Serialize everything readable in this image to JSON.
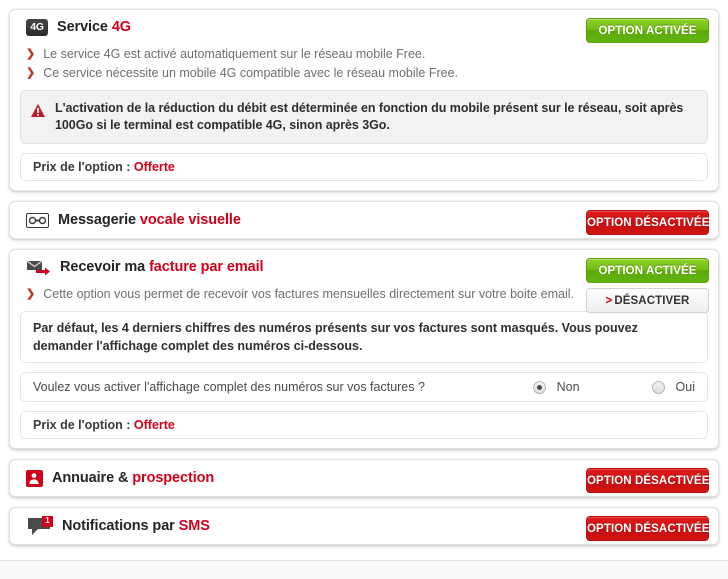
{
  "sections": [
    {
      "id": "service-4g",
      "icon": "4g-badge-icon",
      "icon_text": "4G",
      "title_plain": "Service ",
      "title_highlight": "4G",
      "primary_button": "OPTION ACTIVÉE",
      "bullets": [
        "Le service 4G est activé automatiquement sur le réseau mobile Free.",
        "Ce service nécessite un mobile 4G compatible avec le réseau mobile Free."
      ],
      "warning": "L'activation de la réduction du débit est déterminée en fonction du mobile présent sur le réseau, soit après 100Go si le terminal est compatible 4G, sinon après 3Go.",
      "price_label": "Prix de l'option :",
      "price_value": "Offerte"
    },
    {
      "id": "messagerie-vocale-visuelle",
      "icon": "voicemail-icon",
      "title_plain": "Messagerie ",
      "title_highlight": "vocale visuelle",
      "primary_button": "OPTION DÉSACTIVÉE"
    },
    {
      "id": "facture-par-email",
      "icon": "email-invoice-icon",
      "title_plain": "Recevoir ma ",
      "title_highlight": "facture par email",
      "primary_button": "OPTION ACTIVÉE",
      "secondary_button": "DÉSACTIVER",
      "secondary_chevron": ">",
      "bullets": [
        "Cette option vous permet de recevoir vos factures mensuelles directement sur votre boite email."
      ],
      "info": "Par défaut, les 4 derniers chiffres des numéros présents sur vos factures sont masqués. Vous pouvez demander l'affichage complet des numéros ci-dessous.",
      "radio_question": "Voulez vous activer l'affichage complet des numéros sur vos factures ?",
      "radio_options": [
        {
          "label": "Non",
          "selected": true
        },
        {
          "label": "Oui",
          "selected": false
        }
      ],
      "price_label": "Prix de l'option :",
      "price_value": "Offerte"
    },
    {
      "id": "annuaire-prospection",
      "icon": "directory-icon",
      "title_plain": "Annuaire & ",
      "title_highlight": "prospection",
      "primary_button": "OPTION DÉSACTIVÉE"
    },
    {
      "id": "notifications-sms",
      "icon": "sms-bubble-icon",
      "badge_count": "1",
      "title_plain": "Notifications par ",
      "title_highlight": "SMS",
      "primary_button": "OPTION DÉSACTIVÉE"
    }
  ],
  "colors": {
    "brand_red": "#d0021b",
    "green_button": "#6fbb10",
    "red_button": "#d11313",
    "text_dark": "#242424",
    "text_muted": "#6e6e6e"
  }
}
